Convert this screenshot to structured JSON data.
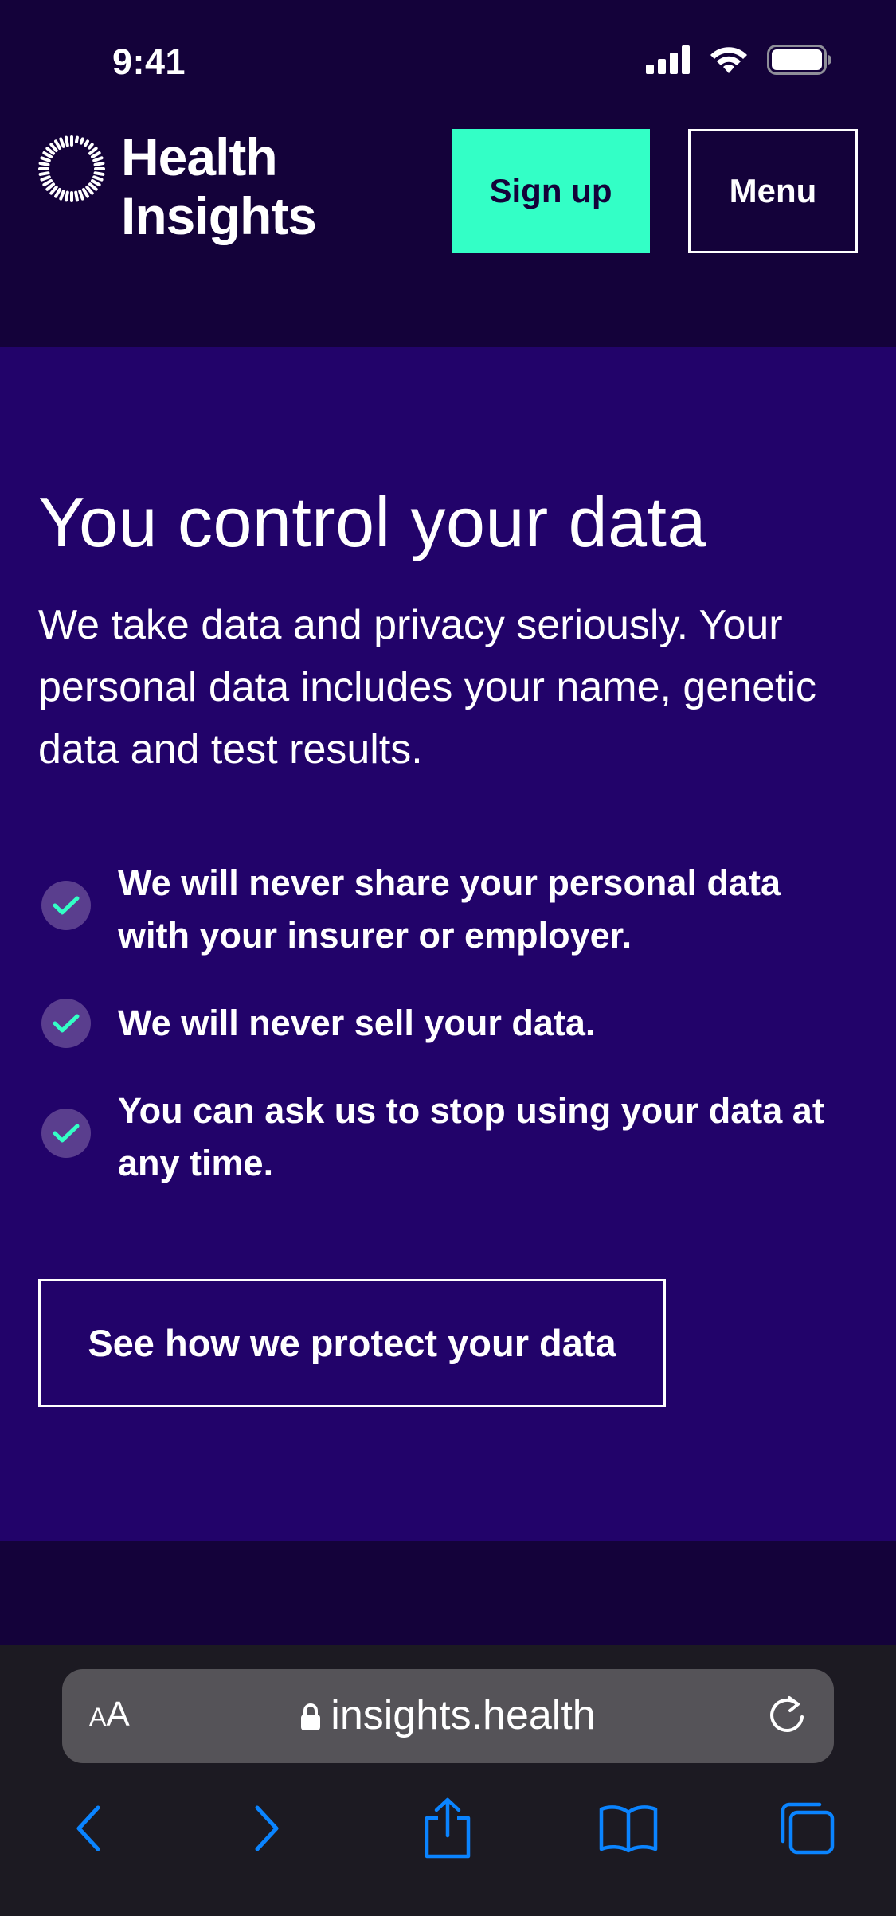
{
  "status_bar": {
    "time": "9:41",
    "icons": [
      "cellular-signal-icon",
      "wifi-icon",
      "battery-icon"
    ]
  },
  "header": {
    "logo_line1": "Health",
    "logo_line2": "Insights",
    "signup_label": "Sign up",
    "menu_label": "Menu"
  },
  "main": {
    "title": "You control your data",
    "intro": "We take data and privacy seriously. Your personal data includes your name, genetic data and test results.",
    "benefits": [
      {
        "text": "We will never share your personal data with your insurer or employer."
      },
      {
        "text": "We will never sell your data."
      },
      {
        "text": "You can ask us to stop using your data at any time."
      }
    ],
    "cta_label": "See how we protect your data"
  },
  "browser": {
    "text_size_large": "A",
    "text_size_small": "A",
    "url": "insights.health",
    "nav_icons": [
      "back-icon",
      "forward-icon",
      "share-icon",
      "bookmarks-icon",
      "tabs-icon"
    ]
  },
  "colors": {
    "header_bg": "#14023a",
    "content_bg": "#22036a",
    "accent": "#33ffc6",
    "check_bg": "#5a3e8e",
    "browser_bar_bg": "#1c1a22",
    "ios_blue": "#0a84ff"
  }
}
